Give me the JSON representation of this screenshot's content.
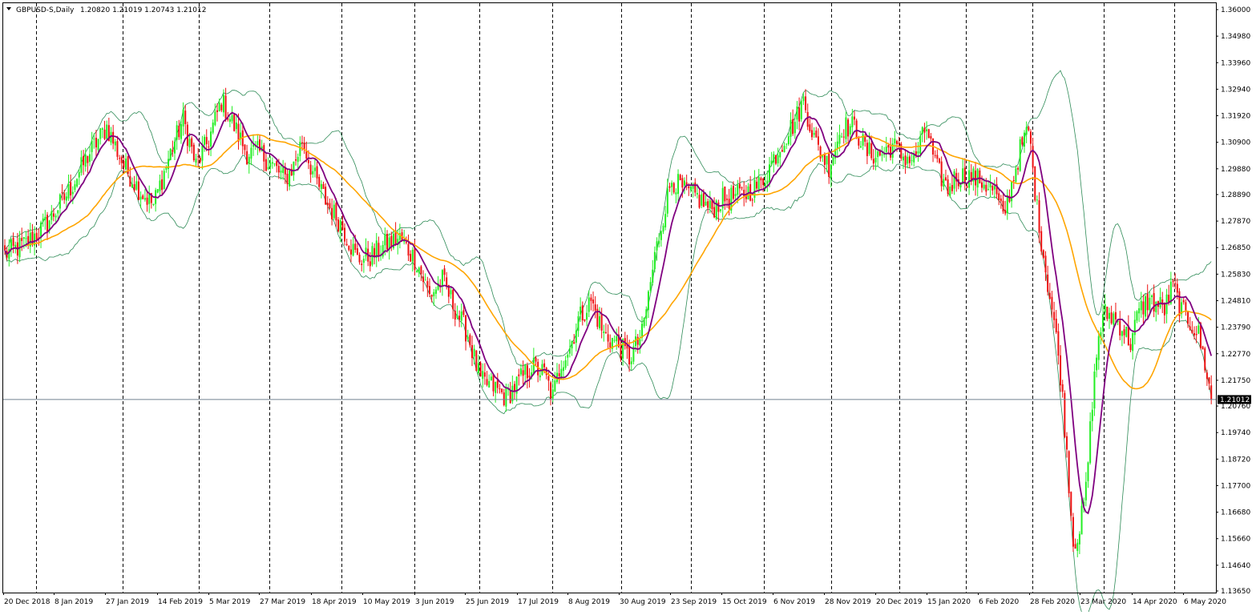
{
  "colors": {
    "background": "#ffffff",
    "grid": "#000000",
    "bull_body": "#22ee22",
    "bear_body": "#ee1111",
    "bollinger": "#2e8b57",
    "ma_fast": "#800080",
    "ma_slow": "#ffa500",
    "price_line": "#708090",
    "price_tag_bg": "#000000",
    "price_tag_text": "#ffffff"
  },
  "header": {
    "title": "GBPUSD-S,Daily",
    "ohlc": "1.20820 1.21019 1.20743 1.21012",
    "menu_icon": "triangle-down-icon"
  },
  "price_tag": "1.21012",
  "chart_data": {
    "type": "candlestick",
    "symbol": "GBPUSD-S",
    "timeframe": "Daily",
    "ylim": [
      1.1365,
      1.36
    ],
    "y_ticks": [
      "1.36000",
      "1.34980",
      "1.33960",
      "1.32940",
      "1.31920",
      "1.30900",
      "1.29880",
      "1.28890",
      "1.27870",
      "1.26850",
      "1.25830",
      "1.24810",
      "1.23790",
      "1.22770",
      "1.21750",
      "1.20760",
      "1.19740",
      "1.18720",
      "1.17700",
      "1.16680",
      "1.15660",
      "1.14640",
      "1.13650"
    ],
    "x_ticks": [
      "20 Dec 2018",
      "8 Jan 2019",
      "27 Jan 2019",
      "14 Feb 2019",
      "5 Mar 2019",
      "27 Mar 2019",
      "18 Apr 2019",
      "10 May 2019",
      "3 Jun 2019",
      "25 Jun 2019",
      "17 Jul 2019",
      "8 Aug 2019",
      "30 Aug 2019",
      "23 Sep 2019",
      "15 Oct 2019",
      "6 Nov 2019",
      "28 Nov 2019",
      "20 Dec 2019",
      "15 Jan 2020",
      "6 Feb 2020",
      "28 Feb 2020",
      "23 Mar 2020",
      "14 Apr 2020",
      "6 May 2020"
    ],
    "close_path": [
      [
        0,
        1.266
      ],
      [
        10,
        1.27
      ],
      [
        20,
        1.278
      ],
      [
        30,
        1.29
      ],
      [
        40,
        1.305
      ],
      [
        48,
        1.315
      ],
      [
        56,
        1.3
      ],
      [
        64,
        1.29
      ],
      [
        70,
        1.285
      ],
      [
        78,
        1.305
      ],
      [
        84,
        1.318
      ],
      [
        90,
        1.3
      ],
      [
        96,
        1.31
      ],
      [
        102,
        1.325
      ],
      [
        108,
        1.315
      ],
      [
        114,
        1.305
      ],
      [
        120,
        1.305
      ],
      [
        126,
        1.3
      ],
      [
        132,
        1.295
      ],
      [
        136,
        1.3
      ],
      [
        140,
        1.31
      ],
      [
        146,
        1.295
      ],
      [
        152,
        1.285
      ],
      [
        158,
        1.278
      ],
      [
        166,
        1.264
      ],
      [
        172,
        1.265
      ],
      [
        180,
        1.27
      ],
      [
        186,
        1.272
      ],
      [
        194,
        1.263
      ],
      [
        200,
        1.25
      ],
      [
        206,
        1.256
      ],
      [
        212,
        1.245
      ],
      [
        218,
        1.235
      ],
      [
        224,
        1.217
      ],
      [
        230,
        1.215
      ],
      [
        236,
        1.211
      ],
      [
        242,
        1.217
      ],
      [
        248,
        1.223
      ],
      [
        254,
        1.22
      ],
      [
        258,
        1.211
      ],
      [
        262,
        1.225
      ],
      [
        266,
        1.23
      ],
      [
        270,
        1.241
      ],
      [
        276,
        1.248
      ],
      [
        282,
        1.235
      ],
      [
        288,
        1.232
      ],
      [
        294,
        1.226
      ],
      [
        300,
        1.235
      ],
      [
        306,
        1.265
      ],
      [
        310,
        1.281
      ],
      [
        314,
        1.295
      ],
      [
        320,
        1.29
      ],
      [
        326,
        1.288
      ],
      [
        332,
        1.283
      ],
      [
        338,
        1.287
      ],
      [
        344,
        1.288
      ],
      [
        350,
        1.29
      ],
      [
        356,
        1.293
      ],
      [
        362,
        1.303
      ],
      [
        368,
        1.312
      ],
      [
        372,
        1.317
      ],
      [
        376,
        1.325
      ],
      [
        382,
        1.308
      ],
      [
        388,
        1.3
      ],
      [
        394,
        1.315
      ],
      [
        400,
        1.315
      ],
      [
        406,
        1.305
      ],
      [
        412,
        1.304
      ],
      [
        418,
        1.308
      ],
      [
        422,
        1.304
      ],
      [
        428,
        1.302
      ],
      [
        434,
        1.315
      ],
      [
        438,
        1.3
      ],
      [
        444,
        1.291
      ],
      [
        448,
        1.296
      ],
      [
        454,
        1.296
      ],
      [
        460,
        1.294
      ],
      [
        466,
        1.29
      ],
      [
        470,
        1.28
      ],
      [
        474,
        1.293
      ],
      [
        478,
        1.306
      ],
      [
        482,
        1.314
      ],
      [
        486,
        1.283
      ],
      [
        490,
        1.26
      ],
      [
        494,
        1.24
      ],
      [
        497,
        1.22
      ],
      [
        500,
        1.19
      ],
      [
        503,
        1.155
      ],
      [
        506,
        1.16
      ],
      [
        509,
        1.175
      ],
      [
        512,
        1.21
      ],
      [
        515,
        1.235
      ],
      [
        518,
        1.243
      ],
      [
        522,
        1.242
      ],
      [
        526,
        1.238
      ],
      [
        530,
        1.232
      ],
      [
        534,
        1.244
      ],
      [
        538,
        1.248
      ],
      [
        542,
        1.247
      ],
      [
        546,
        1.245
      ],
      [
        550,
        1.254
      ],
      [
        554,
        1.244
      ],
      [
        558,
        1.24
      ],
      [
        562,
        1.235
      ],
      [
        566,
        1.22
      ],
      [
        568,
        1.2101
      ]
    ]
  }
}
